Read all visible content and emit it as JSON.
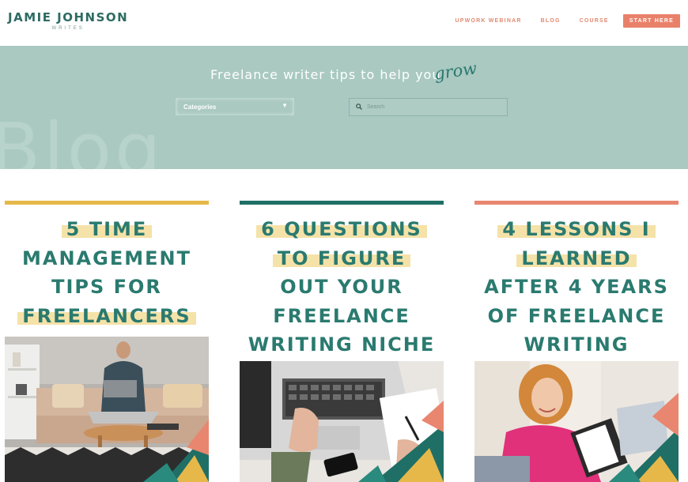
{
  "brand": {
    "name": "JAMIE JOHNSON",
    "tagline": "WRITES"
  },
  "nav": {
    "items": [
      "UPWORK WEBINAR",
      "BLOG",
      "COURSE"
    ],
    "cta": "START HERE"
  },
  "hero": {
    "title": "Freelance writer tips to help you",
    "script_word": "grow",
    "ghost_text": "Blog",
    "categories_label": "Categories",
    "search_placeholder": "Search"
  },
  "posts": [
    {
      "accent": "#e6b84a",
      "lines": [
        "5 TIME",
        "MANAGEMENT",
        "TIPS FOR",
        "FREELANCERS"
      ]
    },
    {
      "accent": "#1f6f66",
      "lines": [
        "6 QUESTIONS",
        "TO FIGURE",
        "OUT YOUR",
        "FREELANCE",
        "WRITING NICHE"
      ]
    },
    {
      "accent": "#e9866f",
      "lines": [
        "4 LESSONS I",
        "LEARNED",
        "AFTER 4 YEARS",
        "OF FREELANCE",
        "WRITING"
      ]
    }
  ],
  "colors": {
    "teal": "#2a7a6f",
    "hero_bg": "#a9c9c1",
    "highlight": "#f5e2a8",
    "coral": "#e9816a"
  }
}
